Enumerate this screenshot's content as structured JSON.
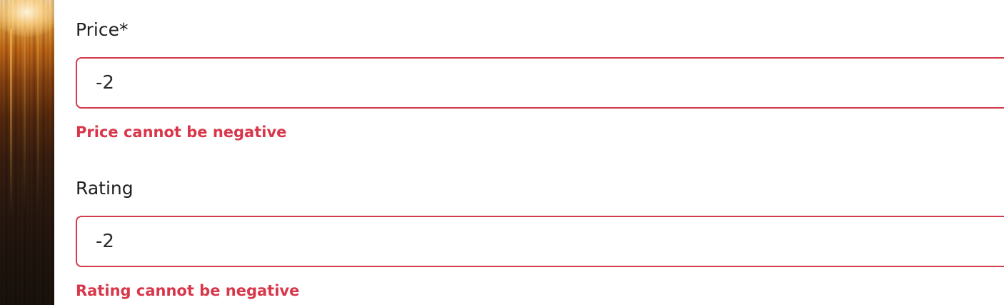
{
  "form": {
    "fields": [
      {
        "label": "Price*",
        "value": "-2",
        "error": "Price cannot be negative"
      },
      {
        "label": "Rating",
        "value": "-2",
        "error": "Rating cannot be negative"
      }
    ]
  },
  "colors": {
    "error": "#d8364a",
    "input_border_error": "#d23b4b",
    "label_text": "#1f1f1f"
  },
  "decorations": {
    "left_panel": "warm-light-photo"
  }
}
